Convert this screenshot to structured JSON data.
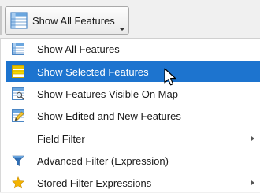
{
  "toolbar": {
    "filter_button_label": "Show All Features",
    "filter_button_icon": "table-icon"
  },
  "menu": {
    "items": [
      {
        "label": "Show All Features",
        "icon": "table-icon",
        "submenu": false,
        "highlighted": false
      },
      {
        "label": "Show Selected Features",
        "icon": "selected-table-icon",
        "submenu": false,
        "highlighted": true
      },
      {
        "label": "Show Features Visible On Map",
        "icon": "map-filter-icon",
        "submenu": false,
        "highlighted": false
      },
      {
        "label": "Show Edited and New Features",
        "icon": "edited-features-icon",
        "submenu": false,
        "highlighted": false
      },
      {
        "label": "Field Filter",
        "icon": "",
        "submenu": true,
        "highlighted": false
      },
      {
        "label": "Advanced Filter (Expression)",
        "icon": "funnel-icon",
        "submenu": false,
        "highlighted": false
      },
      {
        "label": "Stored Filter Expressions",
        "icon": "star-icon",
        "submenu": true,
        "highlighted": false
      }
    ]
  },
  "colors": {
    "highlight": "#1d74cf",
    "menu_background": "#ffffff",
    "toolbar_background": "#f0f0f0"
  }
}
